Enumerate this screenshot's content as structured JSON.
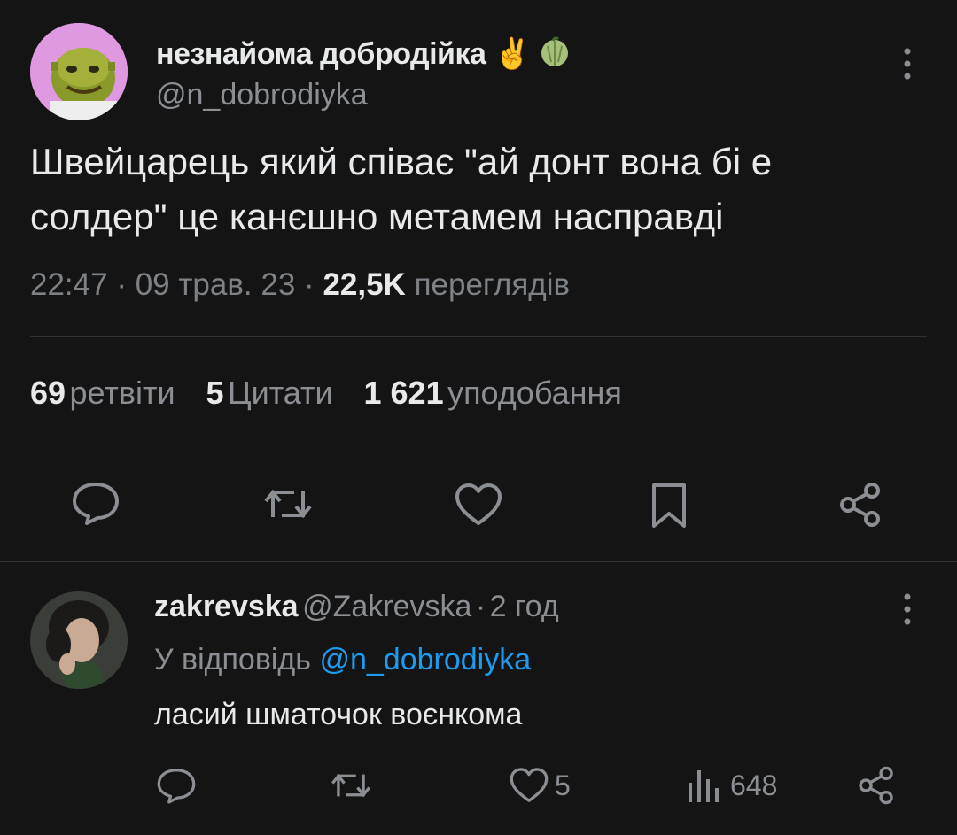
{
  "tweet": {
    "author_name": "незнайома добродійка",
    "emoji_victory": "✌️",
    "handle": "@n_dobrodiyka",
    "text_line1": "Швейцарець який співає \"ай донт вона бі е",
    "text_line2": "солдер\" це канєшно метамем насправді",
    "time": "22:47",
    "date": "09 трав. 23",
    "views_count": "22,5K",
    "views_label": "переглядів",
    "sep": "·"
  },
  "stats": {
    "retweets_count": "69",
    "retweets_label": "ретвіти",
    "quotes_count": "5",
    "quotes_label": "Цитати",
    "likes_count": "1 621",
    "likes_label": "уподобання"
  },
  "reply": {
    "author_name": "zakrevska",
    "handle": "@Zakrevska",
    "sep": "·",
    "time": "2 год",
    "replying_prefix": "У відповідь",
    "replying_to": "@n_dobrodiyka",
    "text": "ласий шматочок воєнкома",
    "likes": "5",
    "views": "648"
  },
  "icons": {
    "more": "more-vertical-icon",
    "reply": "reply-icon",
    "retweet": "retweet-icon",
    "like": "heart-icon",
    "bookmark": "bookmark-icon",
    "share": "share-icon",
    "views": "views-icon",
    "melon": "melon-emoji"
  },
  "colors": {
    "background": "#141414",
    "text": "#e7e9ea",
    "secondary": "#8b8f94",
    "link": "#1d9bf0",
    "divider": "#2f3336"
  }
}
